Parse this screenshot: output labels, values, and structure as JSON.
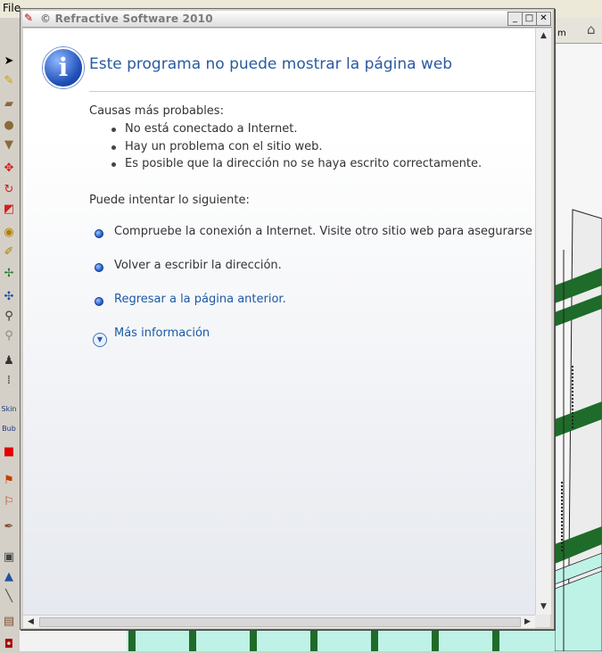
{
  "host": {
    "menu_file": "File",
    "scene_tag": "m",
    "tools": [
      "select-arrow-icon",
      "paint-icon",
      "rectangle-icon",
      "circle-icon",
      "cone-icon",
      "move-icon",
      "rotate-icon",
      "eraser-icon",
      "tape-icon",
      "pencil-icon",
      "axes-icon",
      "orbit-icon",
      "zoom-icon",
      "zoom-window-icon",
      "walk-icon",
      "footprints-icon",
      "skin-icon",
      "bubble-icon",
      "stop-icon",
      "section-icon",
      "north-icon",
      "sandbox-icon",
      "book-icon",
      "compass-icon",
      "line-icon",
      "box-icon",
      "extra-icon"
    ],
    "tool_labels": {
      "skin": "Skin",
      "bubble": "Bub"
    }
  },
  "window": {
    "title": "© Refractive Software 2010",
    "buttons": {
      "minimize": "_",
      "maximize": "□",
      "close": "✕"
    }
  },
  "page": {
    "heading": "Este programa no puede mostrar la página web",
    "causes_label": "Causas más probables:",
    "causes": [
      "No está conectado a Internet.",
      "Hay un problema con el sitio web.",
      "Es posible que la dirección no se haya escrito correctamente."
    ],
    "try_label": "Puede intentar lo siguiente:",
    "actions": [
      {
        "text": "Compruebe la conexión a Internet. Visite otro sitio web para asegurarse de qu",
        "link": false
      },
      {
        "text": "Volver a escribir la dirección.",
        "link": false
      },
      {
        "text": "Regresar a la página anterior.",
        "link": true
      }
    ],
    "more_info": "Más información"
  },
  "colors": {
    "heading": "#2a5aa0",
    "link": "#1c5aa6",
    "green_beams": "#1f6b2a",
    "cyan_panels": "#bff2e6"
  }
}
